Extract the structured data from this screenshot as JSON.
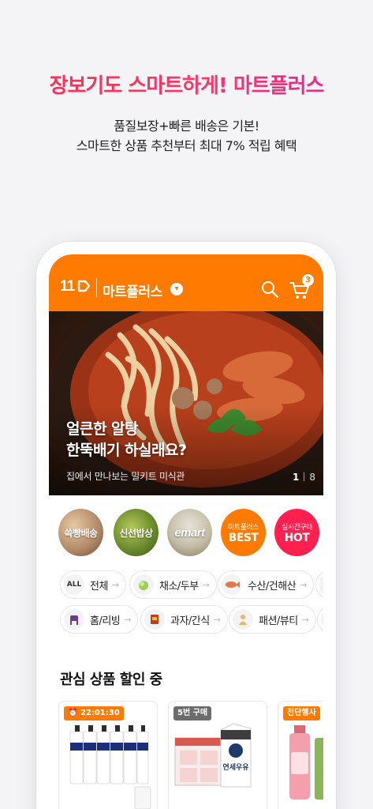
{
  "promo": {
    "headline": "장보기도 스마트하게! 마트플러스",
    "sub_line1": "품질보장+빠른 배송은 기본!",
    "sub_line2": "스마트한 상품 추천부터 최대 7% 적립 혜택"
  },
  "header": {
    "logo": "11",
    "store_name": "마트플러스",
    "cart_count": "3",
    "accent_color": "#ff7a00"
  },
  "hero": {
    "title_line1": "얼큰한 알탕",
    "title_line2": "한뚝배기 하실래요?",
    "description": "집에서 만나보는 밀키트 미식관",
    "page_current": "1",
    "page_total": "8"
  },
  "circles": [
    {
      "label": "쓱빵배송"
    },
    {
      "label": "신선밥상"
    },
    {
      "label": "emart"
    },
    {
      "small": "마트플러스",
      "big": "BEST"
    },
    {
      "small": "실시간구매",
      "big": "HOT"
    }
  ],
  "categories_row1": [
    {
      "icon": "ALL",
      "label": "전체"
    },
    {
      "icon": "vegetable-icon",
      "label": "채소/두부"
    },
    {
      "icon": "fish-icon",
      "label": "수산/건해산"
    }
  ],
  "categories_row2": [
    {
      "icon": "chair-icon",
      "label": "홈/리빙"
    },
    {
      "icon": "snack-icon",
      "label": "과자/간식"
    },
    {
      "icon": "beauty-icon",
      "label": "패션/뷰티"
    }
  ],
  "section": {
    "title": "관심 상품 할인 중"
  },
  "products": [
    {
      "badge": "22:01:30"
    },
    {
      "badge": "5번 구매",
      "product_text": "연세우유"
    },
    {
      "badge": "전단행사"
    }
  ]
}
